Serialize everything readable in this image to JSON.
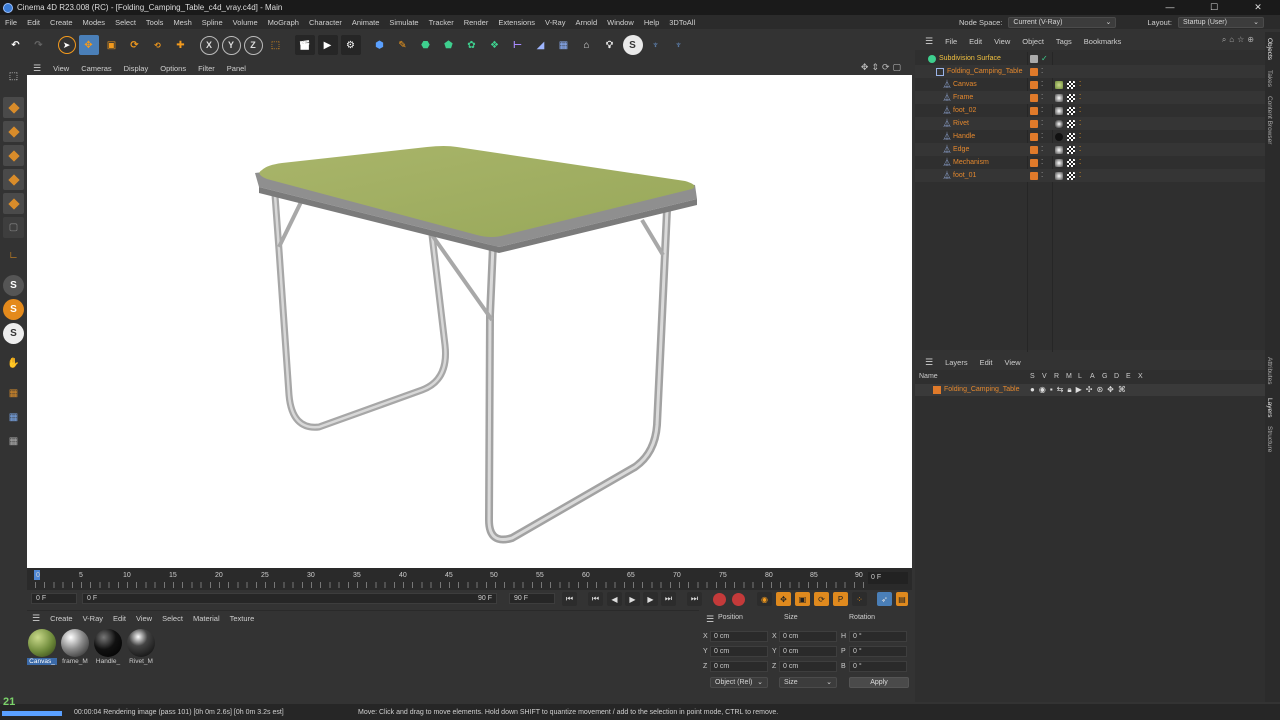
{
  "window": {
    "title": "Cinema 4D R23.008 (RC) - [Folding_Camping_Table_c4d_vray.c4d] - Main",
    "min": "—",
    "max": "☐",
    "close": "✕"
  },
  "menubar": {
    "items": [
      "File",
      "Edit",
      "Create",
      "Modes",
      "Select",
      "Tools",
      "Mesh",
      "Spline",
      "Volume",
      "MoGraph",
      "Character",
      "Animate",
      "Simulate",
      "Tracker",
      "Render",
      "Extensions",
      "V-Ray",
      "Arnold",
      "Window",
      "Help",
      "3DToAll"
    ],
    "node_space_label": "Node Space:",
    "node_space_value": "Current (V-Ray)",
    "layout_label": "Layout:",
    "layout_value": "Startup (User)"
  },
  "toolbar": {
    "x": "X",
    "y": "Y",
    "z": "Z"
  },
  "viewport": {
    "menus": [
      "View",
      "Cameras",
      "Display",
      "Options",
      "Filter",
      "Panel"
    ]
  },
  "timeline": {
    "ticks": [
      "0",
      "5",
      "10",
      "15",
      "20",
      "25",
      "30",
      "35",
      "40",
      "45",
      "50",
      "55",
      "60",
      "65",
      "70",
      "75",
      "80",
      "85",
      "90"
    ],
    "current_frame": "0 F"
  },
  "playback": {
    "start": "0 F",
    "range_start": "0 F",
    "range_end": "90 F",
    "end": "90 F"
  },
  "materials": {
    "menus": [
      "Create",
      "V-Ray",
      "Edit",
      "View",
      "Select",
      "Material",
      "Texture"
    ],
    "items": [
      {
        "label": "Canvas_",
        "color": "#6e8a3a"
      },
      {
        "label": "frame_M",
        "color": "#8a8a8a"
      },
      {
        "label": "Handle_",
        "color": "#111111"
      },
      {
        "label": "Rivet_M",
        "color": "#222222"
      }
    ]
  },
  "coords": {
    "position": "Position",
    "size": "Size",
    "rotation": "Rotation",
    "px": "0 cm",
    "py": "0 cm",
    "pz": "0 cm",
    "sx": "0 cm",
    "sy": "0 cm",
    "sz": "0 cm",
    "rh": "0 °",
    "rp": "0 °",
    "rb": "0 °",
    "lx": "X",
    "ly": "Y",
    "lz": "Z",
    "lsx": "X",
    "lsy": "Y",
    "lsz": "Z",
    "lh": "H",
    "lp": "P",
    "lb": "B",
    "mode": "Object (Rel)",
    "size_mode": "Size",
    "apply": "Apply"
  },
  "objects": {
    "menus": [
      "File",
      "Edit",
      "View",
      "Object",
      "Tags",
      "Bookmarks"
    ],
    "rows": [
      {
        "name": "Subdivision Surface",
        "indent": 0
      },
      {
        "name": "Folding_Camping_Table",
        "indent": 1
      },
      {
        "name": "Canvas",
        "indent": 2
      },
      {
        "name": "Frame",
        "indent": 2
      },
      {
        "name": "foot_02",
        "indent": 2
      },
      {
        "name": "Rivet",
        "indent": 2
      },
      {
        "name": "Handle",
        "indent": 2
      },
      {
        "name": "Edge",
        "indent": 2
      },
      {
        "name": "Mechanism",
        "indent": 2
      },
      {
        "name": "foot_01",
        "indent": 2
      }
    ]
  },
  "layers": {
    "menus": [
      "Layers",
      "Edit",
      "View"
    ],
    "col_name": "Name",
    "cols": [
      "S",
      "V",
      "R",
      "M",
      "L",
      "A",
      "G",
      "D",
      "E",
      "X"
    ],
    "row": "Folding_Camping_Table"
  },
  "sidetabs": [
    "Objects",
    "Takes",
    "Content Browser",
    "Attributes",
    "Layers",
    "Structure"
  ],
  "status": {
    "version": "21",
    "progress": 1.0,
    "render": "00:00:04 Rendering image (pass 101) [0h  0m  2.6s] [0h  0m  3.2s est]",
    "hint": "Move: Click and drag to move elements. Hold down SHIFT to quantize movement / add to the selection in point mode, CTRL to remove."
  }
}
